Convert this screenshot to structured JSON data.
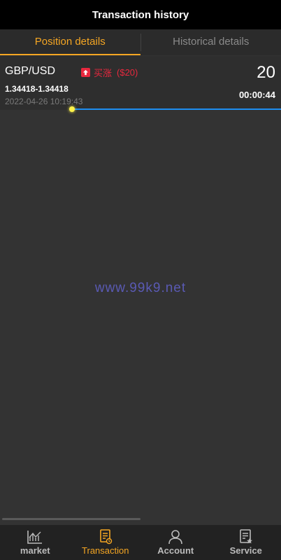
{
  "header": {
    "title": "Transaction history"
  },
  "tabs": [
    {
      "label": "Position details",
      "active": true
    },
    {
      "label": "Historical details",
      "active": false
    }
  ],
  "position": {
    "symbol": "GBP/USD",
    "direction": "买涨",
    "amount": "($20)",
    "quantity": "20",
    "price_range": "1.34418-1.34418",
    "countdown": "00:00:44",
    "open_time": "2022-04-26 10:19:43"
  },
  "watermark": "www.99k9.net",
  "nav": [
    {
      "label": "market",
      "icon": "chart-icon",
      "active": false
    },
    {
      "label": "Transaction",
      "icon": "document-icon",
      "active": true
    },
    {
      "label": "Account",
      "icon": "user-icon",
      "active": false
    },
    {
      "label": "Service",
      "icon": "service-icon",
      "active": false
    }
  ],
  "colors": {
    "accent": "#f5a623",
    "buy_up": "#e8283e",
    "progress": "#1e8ef0",
    "background": "#333333"
  }
}
